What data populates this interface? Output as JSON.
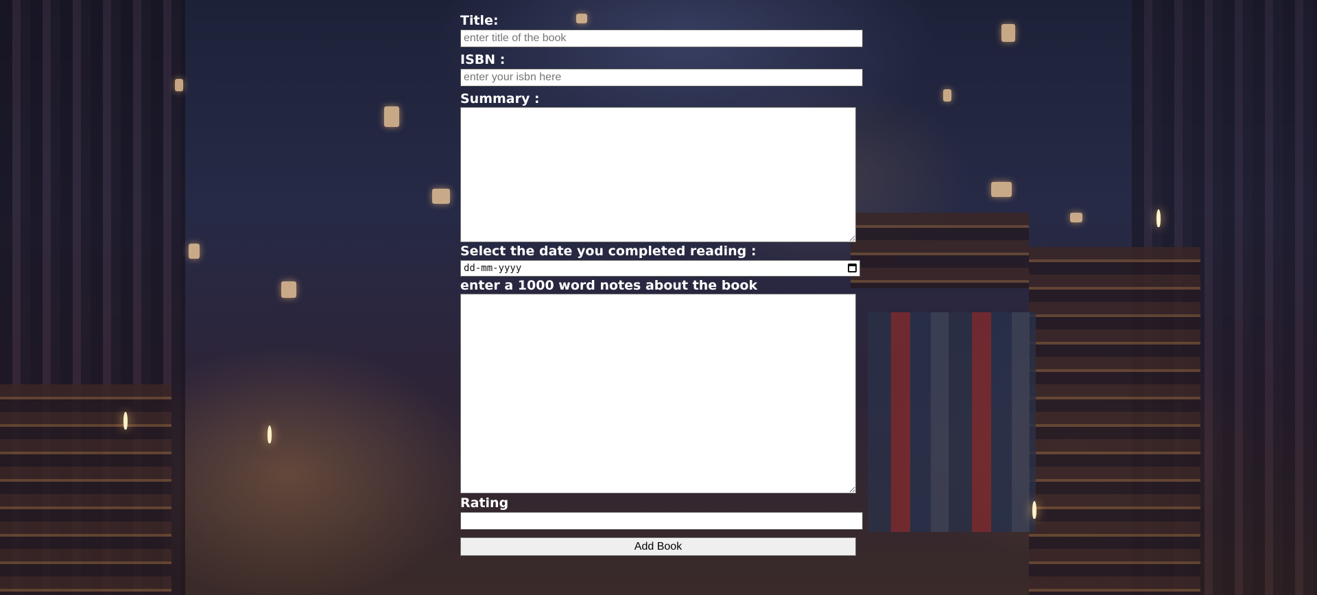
{
  "form": {
    "title_label": "Title:",
    "title_placeholder": "enter title of the book",
    "isbn_label": "ISBN :",
    "isbn_placeholder": "enter your isbn here",
    "summary_label": "Summary :",
    "date_label": "Select the date you completed reading :",
    "date_format": "dd-mm-yyyy",
    "notes_label": "enter a 1000 word notes about the book",
    "rating_label": "Rating",
    "submit_label": "Add Book"
  }
}
